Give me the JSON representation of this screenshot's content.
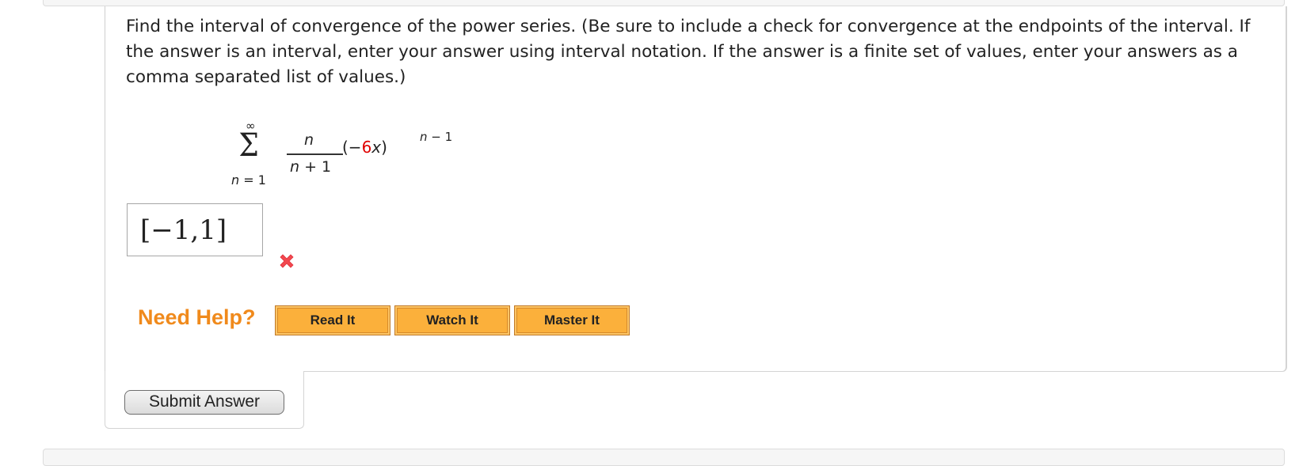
{
  "question": {
    "prompt": "Find the interval of convergence of the power series. (Be sure to include a check for convergence at the endpoints of the interval. If the answer is an interval, enter your answer using interval notation. If the answer is a finite set of values, enter your answers as a comma separated list of values.)",
    "formula": {
      "upper_limit": "∞",
      "lower_limit_var": "n",
      "lower_limit_rest": " = 1",
      "numerator": "n",
      "denominator_var": "n",
      "denominator_rest": " + 1",
      "open_paren": "(−",
      "coefficient": "6",
      "variable": "x",
      "close_paren": ")",
      "exponent_var": "n",
      "exponent_rest": " − 1"
    },
    "coefficient_color": "#e00000"
  },
  "answer": {
    "value": "[−1,1]",
    "status": "incorrect",
    "status_icon": "red-x-icon"
  },
  "help": {
    "label": "Need Help?",
    "buttons": [
      {
        "label": "Read It"
      },
      {
        "label": "Watch It"
      },
      {
        "label": "Master It"
      }
    ]
  },
  "submit": {
    "label": "Submit Answer"
  },
  "colors": {
    "help_text": "#f08a1c",
    "help_button": "#fbb03b",
    "wrong_icon": "#f2484f"
  }
}
